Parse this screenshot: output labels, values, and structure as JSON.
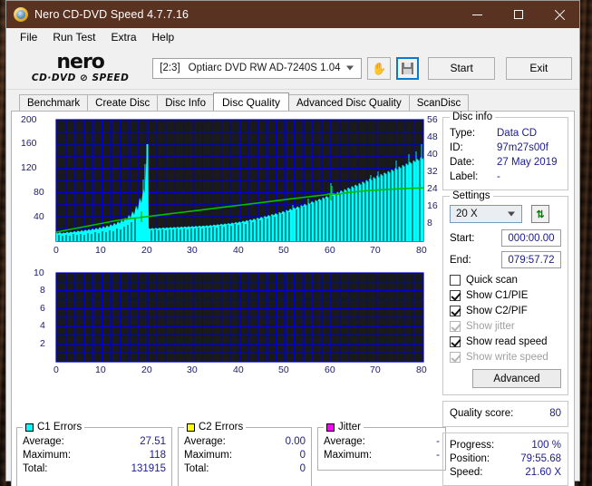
{
  "window": {
    "title": "Nero CD-DVD Speed 4.7.7.16",
    "icon": "nero-disc-icon",
    "minimize": "minimize-icon",
    "maximize": "maximize-icon",
    "close": "close-icon"
  },
  "menu": {
    "items": [
      {
        "label": "File"
      },
      {
        "label": "Run Test"
      },
      {
        "label": "Extra"
      },
      {
        "label": "Help"
      }
    ]
  },
  "logo": {
    "line1": "nero",
    "line2": "CD·DVD ⊘ SPEED"
  },
  "toolbar": {
    "drive_bracket": "[2:3]",
    "drive_name": "Optiarc DVD RW AD-7240S 1.04",
    "eject_icon": "hand-eject-icon",
    "save_icon": "floppy-save-icon",
    "start_label": "Start",
    "exit_label": "Exit"
  },
  "tabs": [
    {
      "label": "Benchmark",
      "active": false
    },
    {
      "label": "Create Disc",
      "active": false
    },
    {
      "label": "Disc Info",
      "active": false
    },
    {
      "label": "Disc Quality",
      "active": true
    },
    {
      "label": "Advanced Disc Quality",
      "active": false
    },
    {
      "label": "ScanDisc",
      "active": false
    }
  ],
  "disc_info": {
    "legend": "Disc info",
    "rows": [
      {
        "key": "Type:",
        "value": "Data CD"
      },
      {
        "key": "ID:",
        "value": "97m27s00f"
      },
      {
        "key": "Date:",
        "value": "27 May 2019"
      },
      {
        "key": "Label:",
        "value": "-"
      }
    ]
  },
  "settings": {
    "legend": "Settings",
    "speed_value": "20 X",
    "refresh_icon": "refresh-icon",
    "start_label": "Start:",
    "start_value": "000:00.00",
    "end_label": "End:",
    "end_value": "079:57.72",
    "checkboxes": [
      {
        "label": "Quick scan",
        "checked": false,
        "disabled": false
      },
      {
        "label": "Show C1/PIE",
        "checked": true,
        "disabled": false
      },
      {
        "label": "Show C2/PIF",
        "checked": true,
        "disabled": false
      },
      {
        "label": "Show jitter",
        "checked": true,
        "disabled": true
      },
      {
        "label": "Show read speed",
        "checked": true,
        "disabled": false
      },
      {
        "label": "Show write speed",
        "checked": true,
        "disabled": true
      }
    ],
    "advanced_label": "Advanced"
  },
  "quality": {
    "label": "Quality score:",
    "value": "80"
  },
  "status": {
    "rows": [
      {
        "key": "Progress:",
        "value": "100 %"
      },
      {
        "key": "Position:",
        "value": "79:55.68"
      },
      {
        "key": "Speed:",
        "value": "21.60 X"
      }
    ]
  },
  "stats": [
    {
      "legend": "C1 Errors",
      "color": "#00ffff",
      "rows": [
        {
          "key": "Average:",
          "value": "27.51"
        },
        {
          "key": "Maximum:",
          "value": "118"
        },
        {
          "key": "Total:",
          "value": "131915"
        }
      ]
    },
    {
      "legend": "C2 Errors",
      "color": "#ffff00",
      "rows": [
        {
          "key": "Average:",
          "value": "0.00"
        },
        {
          "key": "Maximum:",
          "value": "0"
        },
        {
          "key": "Total:",
          "value": "0"
        }
      ]
    },
    {
      "legend": "Jitter",
      "color": "#ff00ff",
      "rows": [
        {
          "key": "Average:",
          "value": "-"
        },
        {
          "key": "Maximum:",
          "value": "-"
        }
      ]
    }
  ],
  "chart_data": [
    {
      "type": "area",
      "id": "c1-errors-chart",
      "title": "C1 Errors",
      "xlabel": "",
      "ylabel": "",
      "xlim": [
        0,
        80
      ],
      "ylim": [
        0,
        200
      ],
      "y2lim": [
        0,
        56
      ],
      "grid": true,
      "bg": "#1a1a1a",
      "gridcolor": "#0000d0",
      "xticks": [
        0,
        10,
        20,
        30,
        40,
        50,
        60,
        70,
        80
      ],
      "yticks": [
        40,
        80,
        120,
        160,
        200
      ],
      "y2ticks": [
        8,
        16,
        24,
        32,
        40,
        48,
        56
      ],
      "series": [
        {
          "name": "C1 Errors",
          "color": "#00ffff",
          "x": [
            0,
            1,
            2,
            3,
            4,
            5,
            6,
            7,
            8,
            9,
            10,
            11,
            12,
            13,
            14,
            15,
            16,
            17,
            18,
            18.6,
            19,
            20,
            21,
            22,
            23,
            24,
            25,
            26,
            27,
            28,
            29,
            30,
            31,
            32,
            33,
            34,
            35,
            36,
            37,
            38,
            39,
            40,
            41,
            42,
            43,
            44,
            45,
            46,
            47,
            48,
            49,
            50,
            51,
            52,
            53,
            54,
            55,
            56,
            57,
            58,
            59,
            60,
            61,
            62,
            63,
            64,
            65,
            66,
            67,
            68,
            69,
            70,
            71,
            72,
            73,
            74,
            75,
            76,
            77,
            78,
            79,
            80
          ],
          "values": [
            14,
            15,
            16,
            17,
            17,
            18,
            18,
            19,
            20,
            22,
            24,
            26,
            28,
            30,
            33,
            38,
            46,
            62,
            90,
            118,
            20,
            18,
            18,
            18,
            18,
            19,
            19,
            20,
            20,
            21,
            21,
            22,
            22,
            23,
            23,
            24,
            24,
            25,
            25,
            26,
            26,
            27,
            27,
            28,
            29,
            30,
            31,
            33,
            35,
            38,
            41,
            44,
            46,
            48,
            50,
            52,
            54,
            56,
            58,
            60,
            64,
            68,
            66,
            68,
            70,
            72,
            74,
            76,
            78,
            80,
            82,
            84,
            86,
            88,
            90,
            92,
            94,
            96,
            98,
            100,
            102
          ]
        },
        {
          "name": "Read speed",
          "color": "#00c000",
          "x": [
            0,
            5,
            10,
            15,
            18.6,
            20,
            25,
            30,
            35,
            40,
            45,
            50,
            55,
            60,
            65,
            70,
            75,
            78,
            80
          ],
          "values_right_axis": [
            9.5,
            10.3,
            11.1,
            12.0,
            13.0,
            13.2,
            14.0,
            14.8,
            15.6,
            16.4,
            17.2,
            18.0,
            18.8,
            19.2,
            20.0,
            20.6,
            21.2,
            21.5,
            21.6
          ]
        }
      ]
    },
    {
      "type": "area",
      "id": "c2-errors-chart",
      "title": "C2 Errors",
      "xlabel": "",
      "ylabel": "",
      "xlim": [
        0,
        80
      ],
      "ylim": [
        0,
        10
      ],
      "grid": true,
      "bg": "#1a1a1a",
      "gridcolor": "#0000d0",
      "xticks": [
        0,
        10,
        20,
        30,
        40,
        50,
        60,
        70,
        80
      ],
      "yticks": [
        2,
        4,
        6,
        8,
        10
      ],
      "series": [
        {
          "name": "C2 Errors",
          "color": "#ffff00",
          "x": [
            0,
            80
          ],
          "values": [
            0,
            0
          ]
        }
      ]
    }
  ]
}
